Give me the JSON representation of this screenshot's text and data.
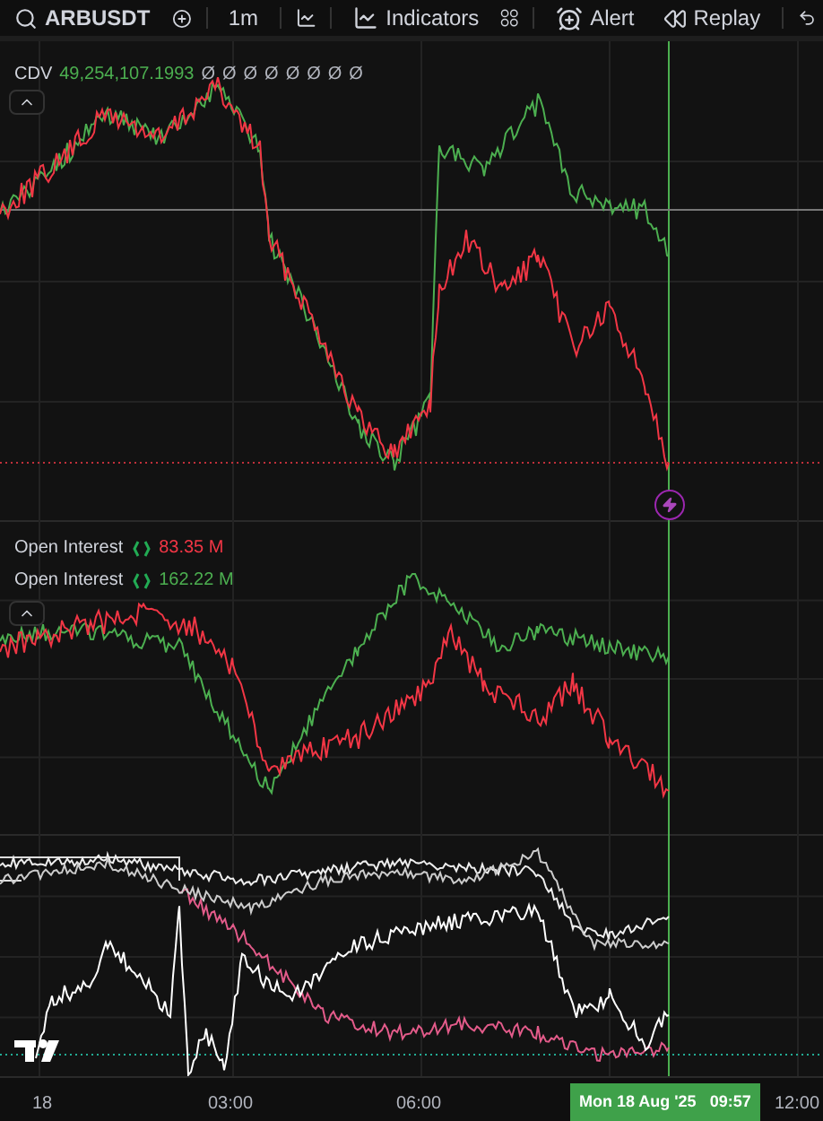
{
  "toolbar": {
    "symbol": "ARBUSDT",
    "interval": "1m",
    "indicators_label": "Indicators",
    "alert_label": "Alert",
    "replay_label": "Replay"
  },
  "cdv_legend": {
    "label": "CDV",
    "value": "49,254,107.1993",
    "extras": [
      "Ø",
      "Ø",
      "Ø",
      "Ø",
      "Ø",
      "Ø",
      "Ø",
      "Ø"
    ]
  },
  "open_interest": [
    {
      "label": "Open Interest",
      "value": "83.35 M",
      "color": "#f23645"
    },
    {
      "label": "Open Interest",
      "value": "162.22 M",
      "color": "#4caf50"
    }
  ],
  "time_axis": {
    "labels": [
      "18",
      "03:00",
      "06:00",
      "12:00"
    ],
    "crosshair_label": "Mon 18 Aug '25   09:57"
  }
}
